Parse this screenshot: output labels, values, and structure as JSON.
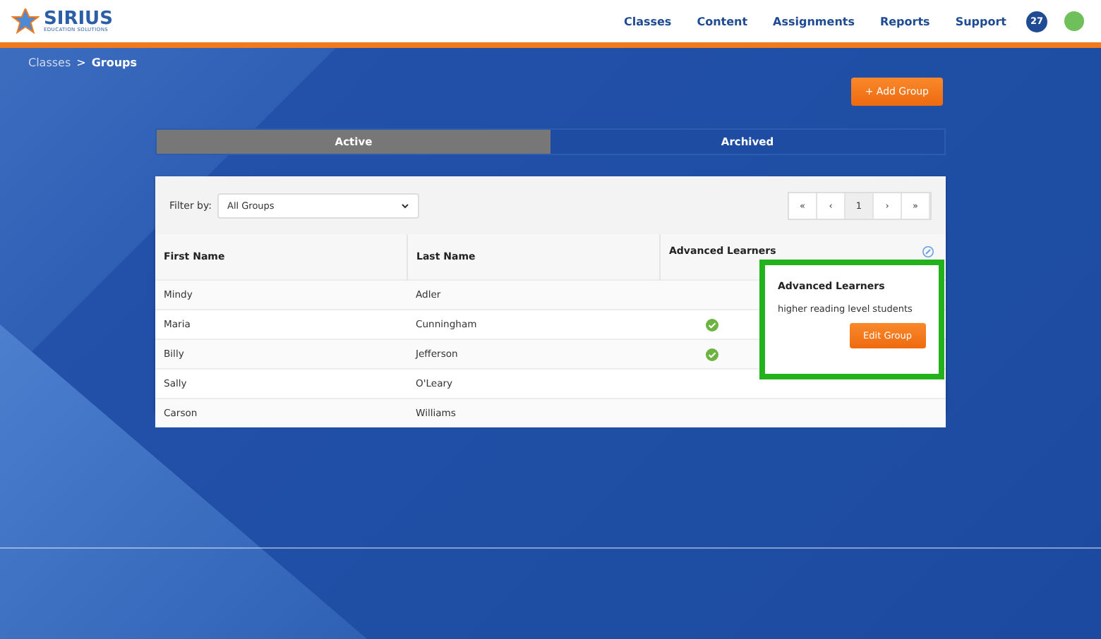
{
  "header": {
    "logo": {
      "name": "SIRIUS",
      "tagline": "EDUCATION SOLUTIONS"
    },
    "nav": [
      "Classes",
      "Content",
      "Assignments",
      "Reports",
      "Support"
    ],
    "notification_count": "27"
  },
  "breadcrumb": {
    "parent": "Classes",
    "separator": ">",
    "current": "Groups"
  },
  "add_button": "+ Add Group",
  "tabs": [
    {
      "label": "Active",
      "selected": true
    },
    {
      "label": "Archived",
      "selected": false
    }
  ],
  "filter": {
    "label": "Filter by:",
    "value": "All Groups"
  },
  "pagination": [
    {
      "label": "«",
      "selected": false
    },
    {
      "label": "‹",
      "selected": false
    },
    {
      "label": "1",
      "selected": true
    },
    {
      "label": "›",
      "selected": false
    },
    {
      "label": "»",
      "selected": false
    }
  ],
  "table": {
    "columns": [
      "First Name",
      "Last Name",
      "Advanced Learners"
    ],
    "rows": [
      {
        "first": "Mindy",
        "last": "Adler",
        "checked": false
      },
      {
        "first": "Maria",
        "last": "Cunningham",
        "checked": true
      },
      {
        "first": "Billy",
        "last": "Jefferson",
        "checked": true
      },
      {
        "first": "Sally",
        "last": "O'Leary",
        "checked": false
      },
      {
        "first": "Carson",
        "last": "Williams",
        "checked": false
      }
    ]
  },
  "popover": {
    "title": "Advanced Learners",
    "description": "higher reading level students",
    "button": "Edit Group"
  }
}
